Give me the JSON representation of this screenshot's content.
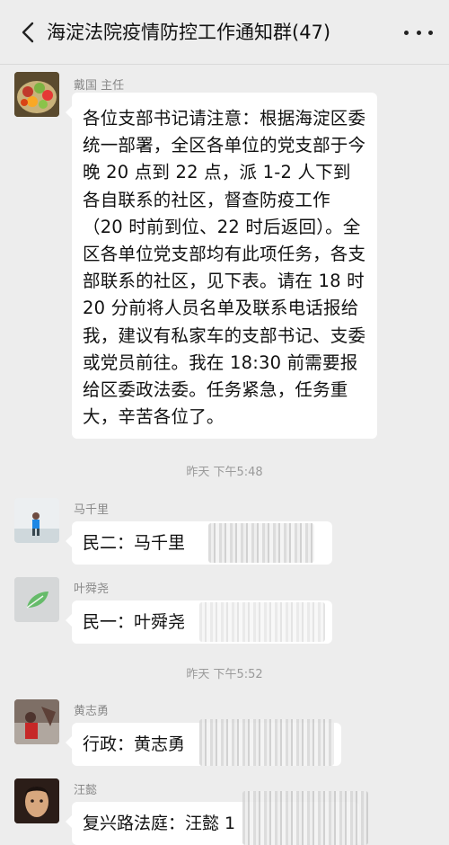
{
  "header": {
    "back_icon": "chevron-left-icon",
    "title": "海淀法院疫情防控工作通知群(47)",
    "more_icon": "more-dots-icon"
  },
  "messages": [
    {
      "sender": "戴国 主任",
      "avatar": "fruit-basket-avatar",
      "text": "各位支部书记请注意：根据海淀区委统一部署，全区各单位的党支部于今晚 20 点到 22 点，派 1-2 人下到各自联系的社区，督查防疫工作（20 时前到位、22 时后返回）。全区各单位党支部均有此项任务，各支部联系的社区，见下表。请在 18 时 20 分前将人员名单及联系电话报给我，建议有私家车的支部书记、支委或党员前往。我在 18:30 前需要报给区委政法委。任务紧急，任务重大，辛苦各位了。"
    },
    {
      "sender": "马千里",
      "avatar": "child-photo-avatar",
      "text": "民二：马千里"
    },
    {
      "sender": "叶舜尧",
      "avatar": "leaf-avatar",
      "text": "民一：叶舜尧"
    },
    {
      "sender": "黄志勇",
      "avatar": "graffiti-wall-avatar",
      "text": "行政：黄志勇"
    },
    {
      "sender": "汪懿",
      "avatar": "man-portrait-avatar",
      "text": "复兴路法庭：汪懿 1"
    }
  ],
  "timestamps": [
    "昨天 下午5:48",
    "昨天 下午5:52"
  ],
  "colors": {
    "background": "#ededed",
    "bubble": "#ffffff",
    "meta_text": "#888888"
  }
}
